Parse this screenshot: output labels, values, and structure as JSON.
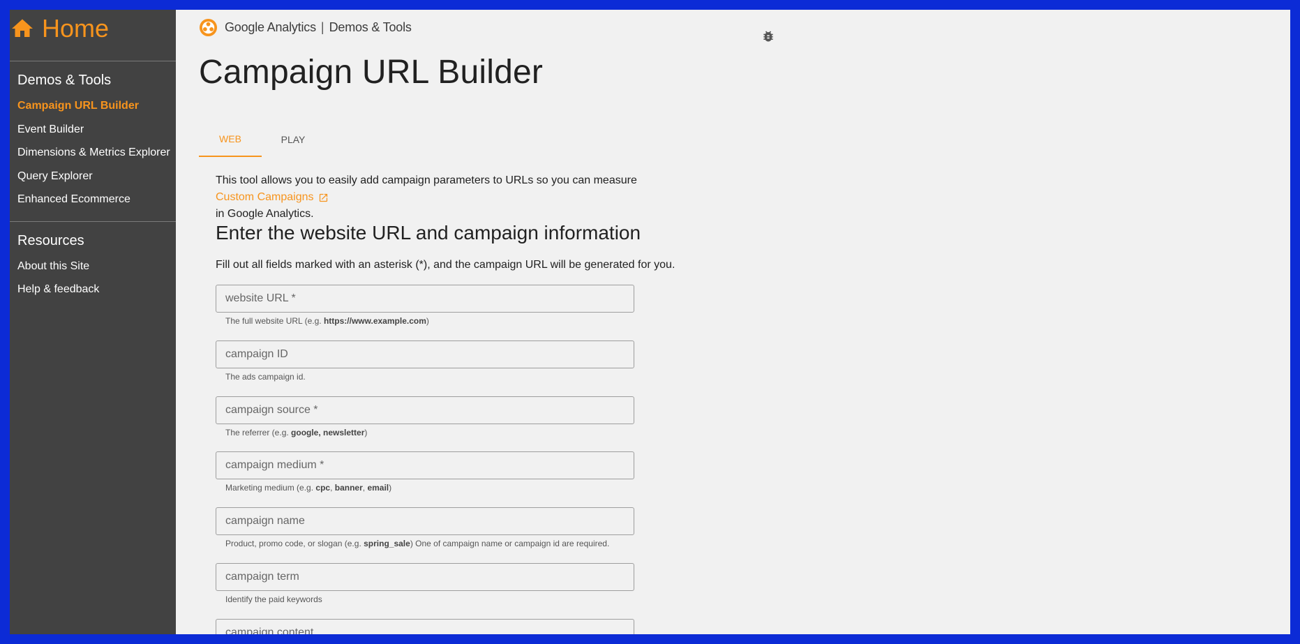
{
  "sidebar": {
    "home_label": "Home",
    "section1_heading": "Demos & Tools",
    "items1": [
      {
        "label": "Campaign URL Builder",
        "active": true
      },
      {
        "label": "Event Builder"
      },
      {
        "label": "Dimensions & Metrics Explorer"
      },
      {
        "label": "Query Explorer"
      },
      {
        "label": "Enhanced Ecommerce"
      }
    ],
    "section2_heading": "Resources",
    "items2": [
      {
        "label": "About this Site"
      },
      {
        "label": "Help & feedback"
      }
    ]
  },
  "header": {
    "brand": "Google Analytics",
    "separator": "|",
    "subtitle": "Demos & Tools"
  },
  "page": {
    "title": "Campaign URL Builder",
    "tabs": [
      {
        "label": "WEB",
        "active": true
      },
      {
        "label": "PLAY"
      }
    ],
    "intro_line1": "This tool allows you to easily add campaign parameters to URLs so you can measure",
    "intro_link": "Custom Campaigns",
    "intro_line3": "in Google Analytics.",
    "section_title": "Enter the website URL and campaign information",
    "instructions": "Fill out all fields marked with an asterisk (*), and the campaign URL will be generated for you."
  },
  "fields": [
    {
      "placeholder": "website URL *",
      "helper_pre": "The full website URL (e.g. ",
      "helper_bold": "https://www.example.com",
      "helper_post": ")"
    },
    {
      "placeholder": "campaign ID",
      "helper_pre": "The ads campaign id.",
      "helper_bold": "",
      "helper_post": ""
    },
    {
      "placeholder": "campaign source *",
      "helper_pre": "The referrer (e.g. ",
      "helper_bold": "google, newsletter",
      "helper_post": ")"
    },
    {
      "placeholder": "campaign medium *",
      "helper_pre": "Marketing medium (e.g. ",
      "helper_bold": "cpc",
      "helper_mid1": ", ",
      "helper_bold2": "banner",
      "helper_mid2": ", ",
      "helper_bold3": "email",
      "helper_post": ")"
    },
    {
      "placeholder": "campaign name",
      "helper_pre": "Product, promo code, or slogan (e.g. ",
      "helper_bold": "spring_sale",
      "helper_post": ") One of campaign name or campaign id are required."
    },
    {
      "placeholder": "campaign term",
      "helper_pre": "Identify the paid keywords",
      "helper_bold": "",
      "helper_post": ""
    },
    {
      "placeholder": "campaign content",
      "helper_pre": "",
      "helper_bold": "",
      "helper_post": ""
    }
  ],
  "colors": {
    "accent": "#f7941d",
    "sidebar_bg": "#424242",
    "page_bg": "#f1f1f1",
    "outer_border": "#0c2bd6"
  },
  "icons": [
    "home-icon",
    "ga-logo-icon",
    "bug-icon",
    "external-link-icon"
  ]
}
